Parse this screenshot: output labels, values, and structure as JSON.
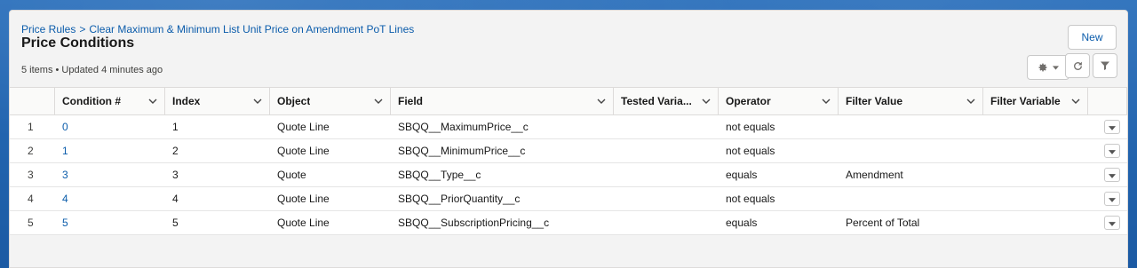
{
  "breadcrumb": {
    "parent": "Price Rules",
    "separator": ">",
    "current": "Clear Maximum & Minimum List Unit Price on Amendment PoT Lines"
  },
  "title": "Price Conditions",
  "meta": "5 items • Updated 4 minutes ago",
  "actions": {
    "new_label": "New"
  },
  "columns": [
    {
      "key": "condition",
      "label": "Condition #"
    },
    {
      "key": "index",
      "label": "Index"
    },
    {
      "key": "object",
      "label": "Object"
    },
    {
      "key": "field",
      "label": "Field"
    },
    {
      "key": "tested",
      "label": "Tested Varia..."
    },
    {
      "key": "operator",
      "label": "Operator"
    },
    {
      "key": "filter_value",
      "label": "Filter Value"
    },
    {
      "key": "filter_variable",
      "label": "Filter Variable"
    }
  ],
  "rows": [
    {
      "num": "1",
      "condition": "0",
      "index": "1",
      "object": "Quote Line",
      "field": "SBQQ__MaximumPrice__c",
      "tested": "",
      "operator": "not equals",
      "filter_value": "",
      "filter_variable": ""
    },
    {
      "num": "2",
      "condition": "1",
      "index": "2",
      "object": "Quote Line",
      "field": "SBQQ__MinimumPrice__c",
      "tested": "",
      "operator": "not equals",
      "filter_value": "",
      "filter_variable": ""
    },
    {
      "num": "3",
      "condition": "3",
      "index": "3",
      "object": "Quote",
      "field": "SBQQ__Type__c",
      "tested": "",
      "operator": "equals",
      "filter_value": "Amendment",
      "filter_variable": ""
    },
    {
      "num": "4",
      "condition": "4",
      "index": "4",
      "object": "Quote Line",
      "field": "SBQQ__PriorQuantity__c",
      "tested": "",
      "operator": "not equals",
      "filter_value": "",
      "filter_variable": ""
    },
    {
      "num": "5",
      "condition": "5",
      "index": "5",
      "object": "Quote Line",
      "field": "SBQQ__SubscriptionPricing__c",
      "tested": "",
      "operator": "equals",
      "filter_value": "Percent of Total",
      "filter_variable": ""
    }
  ],
  "colors": {
    "link": "#0b5cab",
    "header_bg": "#fafaf9",
    "border": "#dddbda"
  }
}
